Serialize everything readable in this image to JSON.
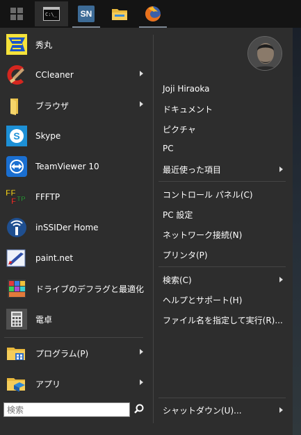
{
  "taskbar": {
    "buttons": [
      {
        "icon": "windows-start-icon"
      },
      {
        "icon": "command-prompt-icon"
      },
      {
        "icon": "simplenote-icon",
        "text": "SN"
      },
      {
        "icon": "file-explorer-icon"
      },
      {
        "icon": "firefox-icon"
      }
    ]
  },
  "programs": [
    {
      "label": "秀丸",
      "icon": "hidemaru-icon"
    },
    {
      "label": "CCleaner",
      "icon": "ccleaner-icon",
      "submenu": true
    },
    {
      "label": "ブラウザ",
      "icon": "folder-icon",
      "submenu": true
    },
    {
      "label": "Skype",
      "icon": "skype-icon"
    },
    {
      "label": "TeamViewer 10",
      "icon": "teamviewer-icon"
    },
    {
      "label": "FFFTP",
      "icon": "ffftp-icon",
      "icon_text": "FFFTP"
    },
    {
      "label": "inSSIDer Home",
      "icon": "inssider-icon"
    },
    {
      "label": "paint.net",
      "icon": "paintnet-icon"
    },
    {
      "label": "ドライブのデフラグと最適化",
      "icon": "defrag-icon"
    },
    {
      "label": "電卓",
      "icon": "calculator-icon"
    }
  ],
  "bottom_programs": [
    {
      "label": "プログラム(P)",
      "icon": "programs-folder-icon",
      "submenu": true
    },
    {
      "label": "アプリ",
      "icon": "apps-folder-icon",
      "submenu": true
    }
  ],
  "search": {
    "placeholder": "検索"
  },
  "right": {
    "user_name": "Joji Hiraoka",
    "items": [
      {
        "label": "ドキュメント"
      },
      {
        "label": "ピクチャ"
      },
      {
        "label": "PC"
      },
      {
        "label": "最近使った項目",
        "submenu": true
      }
    ],
    "items2": [
      {
        "label": "コントロール パネル(C)"
      },
      {
        "label": "PC 設定"
      },
      {
        "label": "ネットワーク接続(N)"
      },
      {
        "label": "プリンタ(P)"
      }
    ],
    "items3": [
      {
        "label": "検索(C)",
        "submenu": true
      },
      {
        "label": "ヘルプとサポート(H)"
      },
      {
        "label": "ファイル名を指定して実行(R)..."
      }
    ],
    "shutdown": {
      "label": "シャットダウン(U)...",
      "submenu": true
    }
  }
}
